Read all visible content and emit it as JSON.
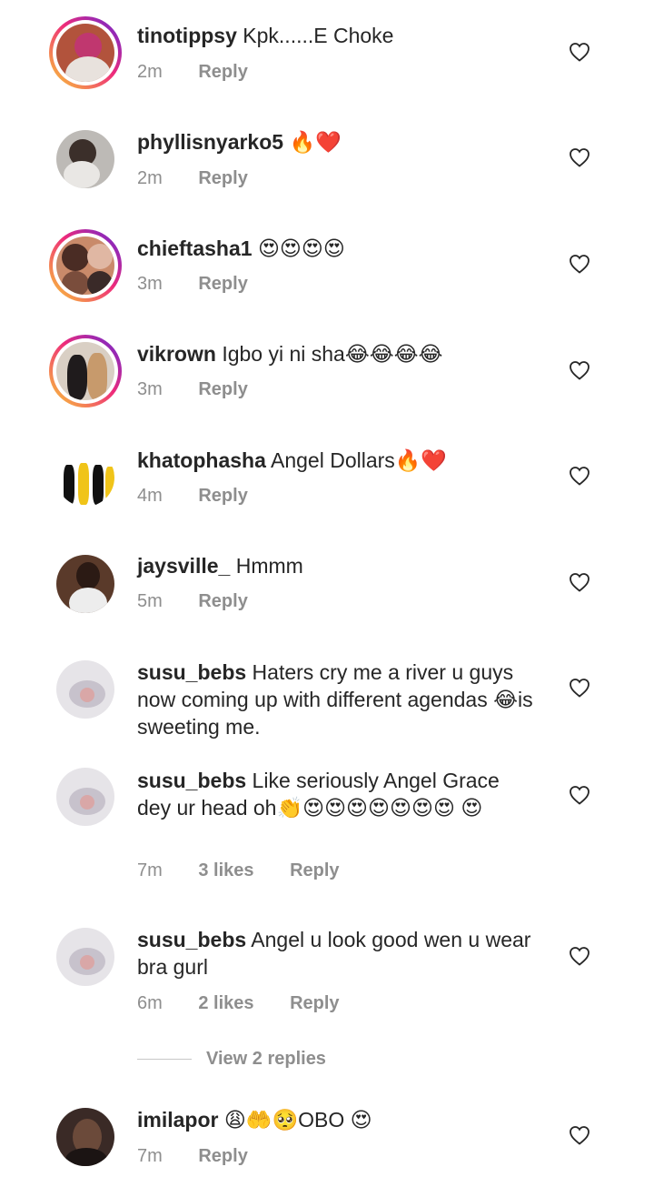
{
  "comments": [
    {
      "user": "tinotippsy",
      "text": "Kpk......E Choke",
      "time": "2m",
      "likes": "",
      "reply": "Reply"
    },
    {
      "user": "phyllisnyarko5",
      "text": "🔥❤️",
      "time": "2m",
      "likes": "",
      "reply": "Reply"
    },
    {
      "user": "chieftasha1",
      "text": "😍😍😍😍",
      "time": "3m",
      "likes": "",
      "reply": "Reply"
    },
    {
      "user": "vikrown",
      "text": "Igbo yi ni sha😂😂😂😂",
      "time": "3m",
      "likes": "",
      "reply": "Reply"
    },
    {
      "user": "khatophasha",
      "text": "Angel Dollars🔥❤️",
      "time": "4m",
      "likes": "",
      "reply": "Reply"
    },
    {
      "user": "jaysville_",
      "text": "Hmmm",
      "time": "5m",
      "likes": "",
      "reply": "Reply"
    },
    {
      "user": "susu_bebs",
      "text": "Haters cry me a river u guys now coming up with different agendas 😂is sweeting me.",
      "time": "",
      "likes": "",
      "reply": ""
    },
    {
      "user": "susu_bebs",
      "text": "Like seriously Angel Grace dey ur head oh👏😍😍😍😍😍😍😍 😍",
      "time": "7m",
      "likes": "3 likes",
      "reply": "Reply"
    },
    {
      "user": "susu_bebs",
      "text": "Angel u look good wen u wear bra gurl",
      "time": "6m",
      "likes": "2 likes",
      "reply": "Reply"
    },
    {
      "user": "imilapor",
      "text": "😩🤲🥺OBO 😍",
      "time": "7m",
      "likes": "",
      "reply": "Reply"
    }
  ],
  "view_replies": "View 2 replies",
  "icons": {
    "like": "heart-outline-icon"
  },
  "colors": {
    "muted": "#8e8e8e",
    "text": "#262626"
  }
}
